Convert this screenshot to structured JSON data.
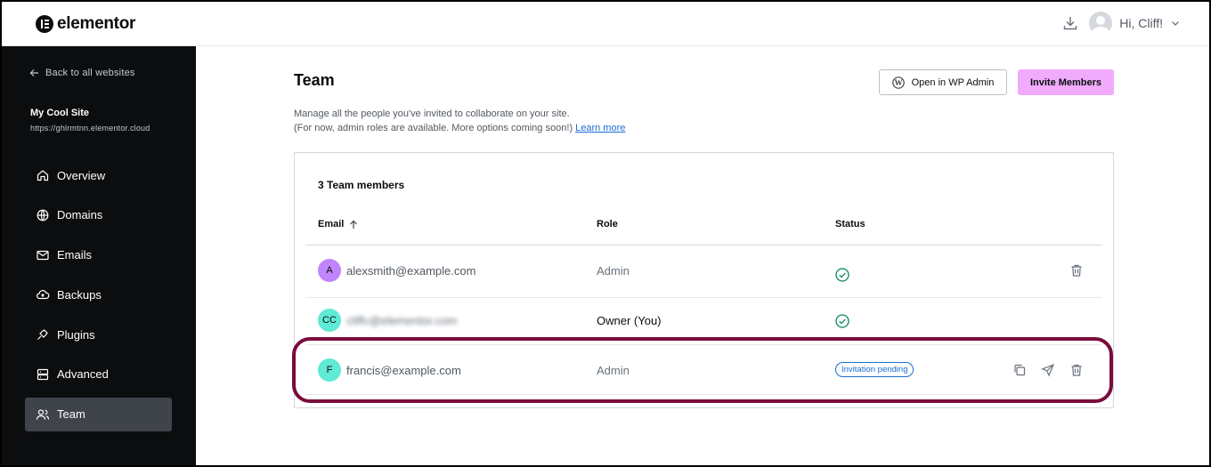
{
  "header": {
    "logo_text": "elementor",
    "greeting": "Hi, Cliff!"
  },
  "sidebar": {
    "back_label": "Back to all websites",
    "site_name": "My Cool Site",
    "site_url": "https://ghlrmtnn.elementor.cloud",
    "items": [
      {
        "label": "Overview",
        "icon": "home-icon"
      },
      {
        "label": "Domains",
        "icon": "globe-icon"
      },
      {
        "label": "Emails",
        "icon": "mail-icon"
      },
      {
        "label": "Backups",
        "icon": "cloud-icon"
      },
      {
        "label": "Plugins",
        "icon": "plug-icon"
      },
      {
        "label": "Advanced",
        "icon": "server-icon"
      },
      {
        "label": "Team",
        "icon": "users-icon",
        "active": true
      }
    ]
  },
  "main": {
    "title": "Team",
    "description_line1": "Manage all the people you've invited to collaborate on your site.",
    "description_line2": "(For now, admin roles are available. More options coming soon!)",
    "learn_more": "Learn more",
    "open_wp_admin": "Open in WP Admin",
    "invite_members": "Invite Members"
  },
  "team": {
    "count_label": "3 Team members",
    "columns": {
      "email": "Email",
      "role": "Role",
      "status": "Status"
    },
    "members": [
      {
        "initials": "A",
        "email": "alexsmith@example.com",
        "role": "Admin",
        "status": "active",
        "avatar_color": "#c084fc"
      },
      {
        "initials": "CC",
        "email": "cliffc@elementor.com",
        "role": "Owner (You)",
        "status": "active",
        "avatar_color": "#5eead4"
      },
      {
        "initials": "F",
        "email": "francis@example.com",
        "role": "Admin",
        "status": "Invitation pending",
        "avatar_color": "#5eead4"
      }
    ]
  },
  "colors": {
    "accent_pink": "#f0abfc",
    "highlight": "#7a0b3b",
    "status_green": "#0a875a",
    "link_blue": "#1a6dd6"
  }
}
